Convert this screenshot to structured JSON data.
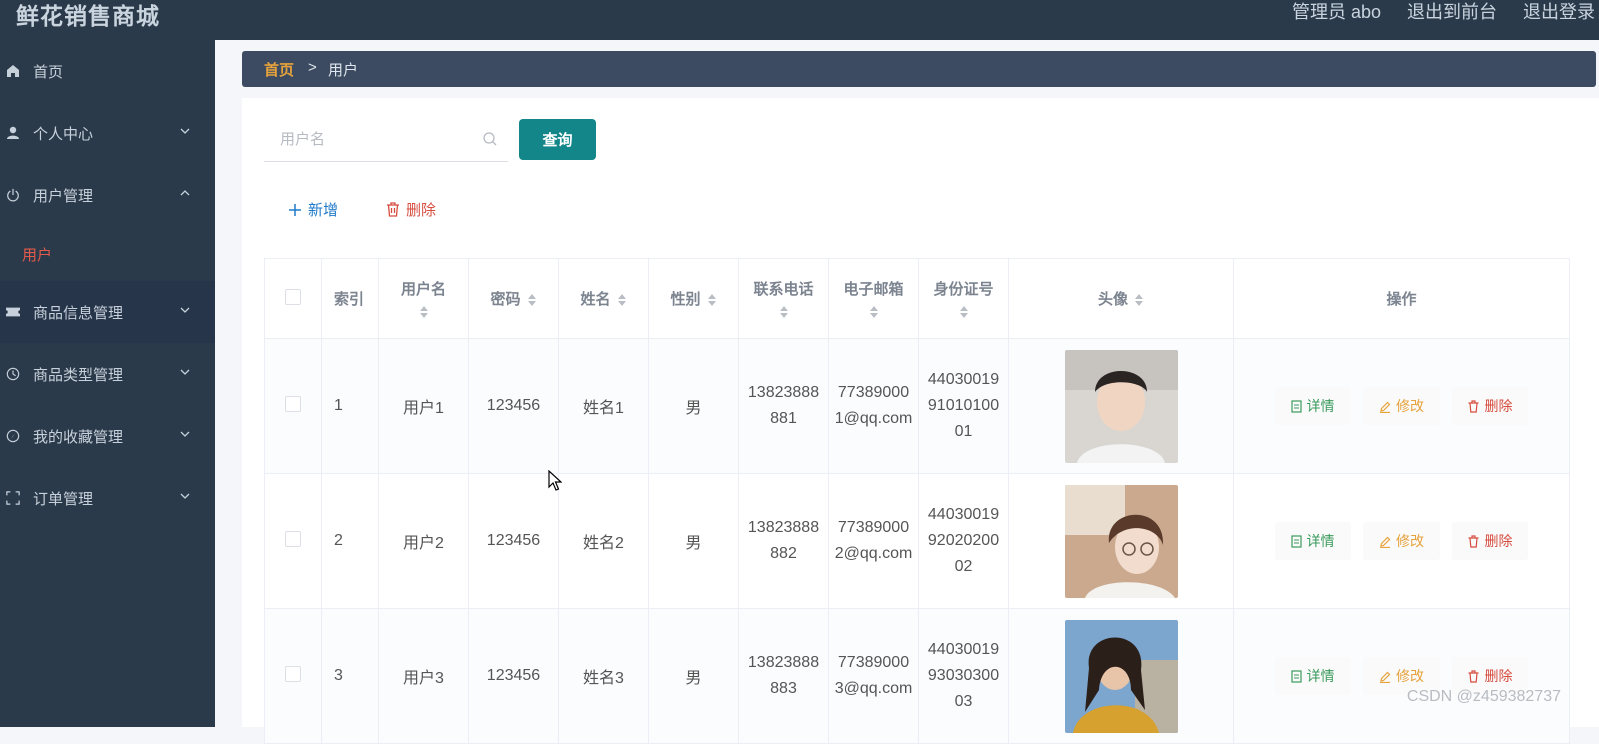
{
  "header": {
    "title": "鲜花销售商城",
    "links": [
      "管理员 abo",
      "退出到前台",
      "退出登录"
    ]
  },
  "sidebar": {
    "items": [
      {
        "label": "首页",
        "icon": "home-icon"
      },
      {
        "label": "个人中心",
        "icon": "user-icon"
      },
      {
        "label": "用户管理",
        "icon": "power-icon",
        "expanded": true
      },
      {
        "label": "商品信息管理",
        "icon": "ticket-icon"
      },
      {
        "label": "商品类型管理",
        "icon": "clock-icon"
      },
      {
        "label": "我的收藏管理",
        "icon": "compass-icon"
      },
      {
        "label": "订单管理",
        "icon": "frame-icon"
      }
    ],
    "sub_active": "用户"
  },
  "breadcrumb": {
    "home": "首页",
    "separator": ">",
    "current": "用户"
  },
  "search": {
    "placeholder": "用户名",
    "value": "",
    "button": "查询"
  },
  "actions": {
    "add": "新增",
    "delete": "删除"
  },
  "table": {
    "columns": [
      "索引",
      "用户名",
      "密码",
      "姓名",
      "性别",
      "联系电话",
      "电子邮箱",
      "身份证号",
      "头像",
      "操作"
    ],
    "rows": [
      {
        "index": "1",
        "username": "用户1",
        "password": "123456",
        "name": "姓名1",
        "gender": "男",
        "phone": "13823888881",
        "email": "773890001@qq.com",
        "idcard": "440300199101010001"
      },
      {
        "index": "2",
        "username": "用户2",
        "password": "123456",
        "name": "姓名2",
        "gender": "男",
        "phone": "13823888882",
        "email": "773890002@qq.com",
        "idcard": "440300199202020002"
      },
      {
        "index": "3",
        "username": "用户3",
        "password": "123456",
        "name": "姓名3",
        "gender": "男",
        "phone": "13823888883",
        "email": "773890003@qq.com",
        "idcard": "440300199303030003"
      }
    ],
    "row_actions": {
      "detail": "详情",
      "edit": "修改",
      "delete": "删除"
    }
  },
  "watermark": "CSDN @z459382737",
  "colors": {
    "header_bg": "#2b3a4a",
    "breadcrumb_bg": "#3c4b61",
    "accent_home": "#e6a23c",
    "query_button": "#13868a",
    "add_blue": "#1f7ac9",
    "delete_red": "#d64c3f",
    "detail_green": "#3a9b5c",
    "edit_orange": "#e6a23c"
  }
}
